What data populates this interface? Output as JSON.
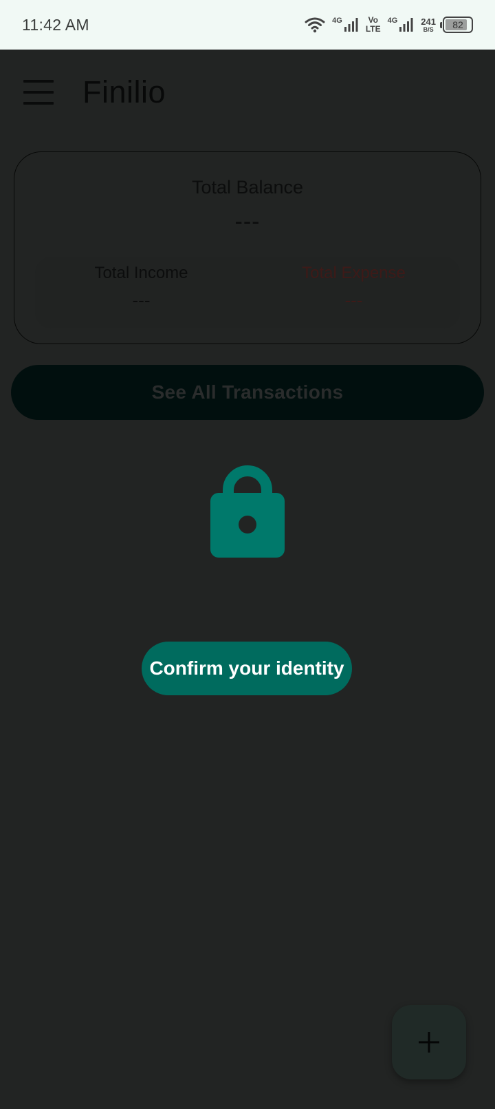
{
  "status_bar": {
    "time": "11:42 AM",
    "net1": "4G",
    "volte_top": "Vo",
    "volte_bottom": "LTE",
    "net2": "4G",
    "speed_value": "241",
    "speed_unit": "B/S",
    "battery": "82",
    "icons": [
      "wifi-icon",
      "signal-icon",
      "signal-icon",
      "battery-icon"
    ]
  },
  "app_bar": {
    "title": "Finilio",
    "menu_icon": "menu-icon"
  },
  "summary": {
    "title": "Total Balance",
    "balance": "---",
    "income_label": "Total Income",
    "income_value": "---",
    "expense_label": "Total Expense",
    "expense_value": "---"
  },
  "actions": {
    "see_all": "See All Transactions",
    "confirm": "Confirm your identity"
  },
  "lock_icon": "lock-icon",
  "fab_icon": "plus-icon",
  "colors": {
    "accent": "#006b5e",
    "lock": "#00796b",
    "scrim_background": "#222423",
    "status_bar": "#f1f9f5"
  }
}
